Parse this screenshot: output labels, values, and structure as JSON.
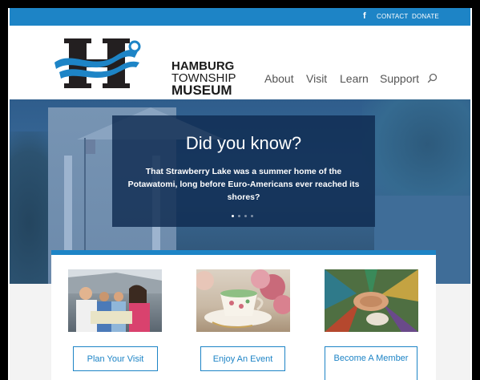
{
  "topbar": {
    "facebook_glyph": "f",
    "contact": "CONTACT",
    "donate": "DONATE",
    "color": "#1d84c6"
  },
  "logo": {
    "line1": "HAMBURG",
    "line2": "TOWNSHIP",
    "line3": "MUSEUM"
  },
  "nav": {
    "items": [
      "About",
      "Visit",
      "Learn",
      "Support"
    ],
    "search_icon": "search-icon"
  },
  "hero": {
    "title": "Did you know?",
    "body": "That Strawberry Lake was a summer home of the Potawatomi, long before Euro-Americans ever reached its shores?",
    "slides": 4,
    "active_slide": 1
  },
  "cards": [
    {
      "button": "Plan Your Visit",
      "image": "family-with-map"
    },
    {
      "button": "Enjoy An Event",
      "image": "teacup-and-roses"
    },
    {
      "button": "Become A Member",
      "image": "stacked-hands"
    }
  ],
  "colors": {
    "accent": "#1d84c6",
    "overlay": "#0f2b50"
  }
}
